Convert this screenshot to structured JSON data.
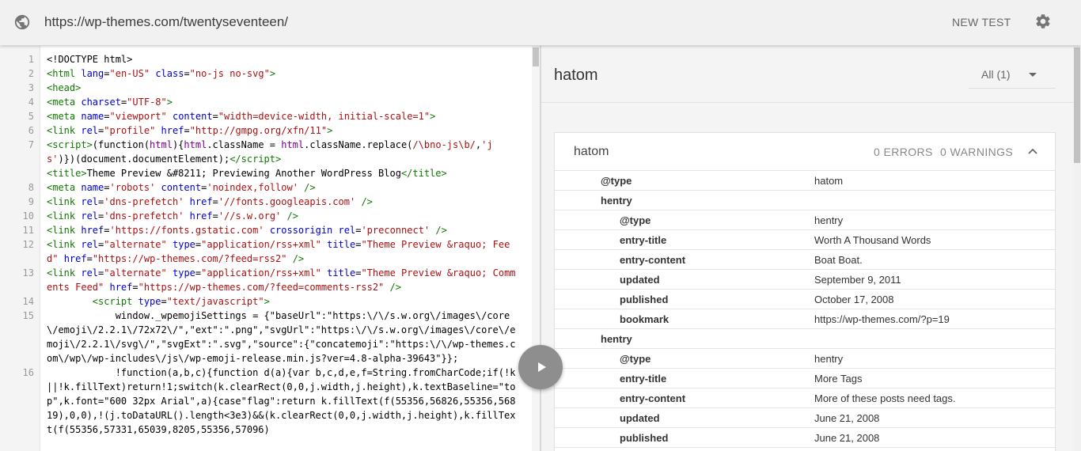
{
  "topbar": {
    "url": "https://wp-themes.com/twentyseventeen/",
    "new_test_label": "NEW TEST",
    "globe_icon": "globe-icon",
    "settings_icon": "gear-icon"
  },
  "code_lines": [
    {
      "n": "1",
      "html": "&lt;!DOCTYPE html&gt;"
    },
    {
      "n": "2",
      "html": "<span class=\"t\">&lt;html</span> <span class=\"a\">lang</span>=<span class=\"v\">\"en-US\"</span> <span class=\"a\">class</span>=<span class=\"v\">\"no-js no-svg\"</span><span class=\"t\">&gt;</span>"
    },
    {
      "n": "3",
      "html": "<span class=\"t\">&lt;head&gt;</span>"
    },
    {
      "n": "4",
      "html": "<span class=\"t\">&lt;meta</span> <span class=\"a\">charset</span>=<span class=\"v\">\"UTF-8\"</span><span class=\"t\">&gt;</span>"
    },
    {
      "n": "5",
      "html": "<span class=\"t\">&lt;meta</span> <span class=\"a\">name</span>=<span class=\"v\">\"viewport\"</span> <span class=\"a\">content</span>=<span class=\"v\">\"width=device-width, initial-scale=1\"</span><span class=\"t\">&gt;</span>"
    },
    {
      "n": "6",
      "html": "<span class=\"t\">&lt;link</span> <span class=\"a\">rel</span>=<span class=\"v\">\"profile\"</span> <span class=\"a\">href</span>=<span class=\"v\">\"http://gmpg.org/xfn/11\"</span><span class=\"t\">&gt;</span>"
    },
    {
      "n": "7",
      "html": "<span class=\"t\">&lt;script&gt;</span>(function(<span class=\"k\">html</span>){<span class=\"k\">html</span>.className = <span class=\"k\">html</span>.className.replace(<span class=\"v\">/\\bno-js\\b/</span>,<span class=\"v\">'js'</span>)})(document.documentElement);<span class=\"t\">&lt;/script&gt;</span>"
    },
    {
      "n": "7",
      "html": "<span class=\"t\">&lt;title&gt;</span>Theme Preview &amp;#8211; Previewing Another WordPress Blog<span class=\"t\">&lt;/title&gt;</span>",
      "hide_num": true
    },
    {
      "n": "8",
      "html": "<span class=\"t\">&lt;meta</span> <span class=\"a\">name</span>=<span class=\"v\">'robots'</span> <span class=\"a\">content</span>=<span class=\"v\">'noindex,follow'</span> <span class=\"t\">/&gt;</span>"
    },
    {
      "n": "9",
      "html": "<span class=\"t\">&lt;link</span> <span class=\"a\">rel</span>=<span class=\"v\">'dns-prefetch'</span> <span class=\"a\">href</span>=<span class=\"v\">'//fonts.googleapis.com'</span> <span class=\"t\">/&gt;</span>"
    },
    {
      "n": "10",
      "html": "<span class=\"t\">&lt;link</span> <span class=\"a\">rel</span>=<span class=\"v\">'dns-prefetch'</span> <span class=\"a\">href</span>=<span class=\"v\">'//s.w.org'</span> <span class=\"t\">/&gt;</span>"
    },
    {
      "n": "11",
      "html": "<span class=\"t\">&lt;link</span> <span class=\"a\">href</span>=<span class=\"v\">'https://fonts.gstatic.com'</span> <span class=\"a\">crossorigin</span> <span class=\"a\">rel</span>=<span class=\"v\">'preconnect'</span> <span class=\"t\">/&gt;</span>"
    },
    {
      "n": "12",
      "html": "<span class=\"t\">&lt;link</span> <span class=\"a\">rel</span>=<span class=\"v\">\"alternate\"</span> <span class=\"a\">type</span>=<span class=\"v\">\"application/rss+xml\"</span> <span class=\"a\">title</span>=<span class=\"v\">\"Theme Preview &amp;raquo; Feed\"</span> <span class=\"a\">href</span>=<span class=\"v\">\"https://wp-themes.com/?feed=rss2\"</span> <span class=\"t\">/&gt;</span>"
    },
    {
      "n": "13",
      "html": "<span class=\"t\">&lt;link</span> <span class=\"a\">rel</span>=<span class=\"v\">\"alternate\"</span> <span class=\"a\">type</span>=<span class=\"v\">\"application/rss+xml\"</span> <span class=\"a\">title</span>=<span class=\"v\">\"Theme Preview &amp;raquo; Comments Feed\"</span> <span class=\"a\">href</span>=<span class=\"v\">\"https://wp-themes.com/?feed=comments-rss2\"</span> <span class=\"t\">/&gt;</span>"
    },
    {
      "n": "14",
      "html": "        <span class=\"t\">&lt;script</span> <span class=\"a\">type</span>=<span class=\"v\">\"text/javascript\"</span><span class=\"t\">&gt;</span>"
    },
    {
      "n": "15",
      "html": "            window._wpemojiSettings = {\"baseUrl\":\"https:\\/\\/s.w.org\\/images\\/core\\/emoji\\/2.2.1\\/72x72\\/\",\"ext\":\".png\",\"svgUrl\":\"https:\\/\\/s.w.org\\/images\\/core\\/emoji\\/2.2.1\\/svg\\/\",\"svgExt\":\".svg\",\"source\":{\"concatemoji\":\"https:\\/\\/wp-themes.com\\/wp\\/wp-includes\\/js\\/wp-emoji-release.min.js?ver=4.8-alpha-39643\"}};"
    },
    {
      "n": "16",
      "html": "            !function(a,b,c){function d(a){var b,c,d,e,f=String.fromCharCode;if(!k||!k.fillText)return!1;switch(k.clearRect(0,0,j.width,j.height),k.textBaseline=\"top\",k.font=\"600 32px Arial\",a){case\"flag\":return k.fillText(f(55356,56826,55356,56819),0,0),!(j.toDataURL().length&lt;3e3)&amp;&amp;(k.clearRect(0,0,j.width,j.height),k.fillText(f(55356,57331,65039,8205,55356,57096)"
    }
  ],
  "right_panel": {
    "title": "hatom",
    "filter_label": "All (1)",
    "card": {
      "title": "hatom",
      "errors": "0 ERRORS",
      "warnings": "0 WARNINGS",
      "rows": [
        {
          "level": 1,
          "key": "@type",
          "value": "hatom"
        },
        {
          "level": 1,
          "key": "hentry",
          "value": ""
        },
        {
          "level": 2,
          "key": "@type",
          "value": "hentry"
        },
        {
          "level": 2,
          "key": "entry-title",
          "value": "Worth A Thousand Words"
        },
        {
          "level": 2,
          "key": "entry-content",
          "value": "Boat Boat."
        },
        {
          "level": 2,
          "key": "updated",
          "value": "September 9, 2011"
        },
        {
          "level": 2,
          "key": "published",
          "value": "October 17, 2008"
        },
        {
          "level": 2,
          "key": "bookmark",
          "value": "https://wp-themes.com/?p=19"
        },
        {
          "level": 1,
          "key": "hentry",
          "value": ""
        },
        {
          "level": 2,
          "key": "@type",
          "value": "hentry"
        },
        {
          "level": 2,
          "key": "entry-title",
          "value": "More Tags"
        },
        {
          "level": 2,
          "key": "entry-content",
          "value": "More of these posts need tags."
        },
        {
          "level": 2,
          "key": "updated",
          "value": "June 21, 2008"
        },
        {
          "level": 2,
          "key": "published",
          "value": "June 21, 2008"
        }
      ]
    }
  },
  "colors": {
    "tag": "#117700",
    "attr": "#0000cc",
    "string": "#aa1111",
    "keyword": "#770088"
  }
}
